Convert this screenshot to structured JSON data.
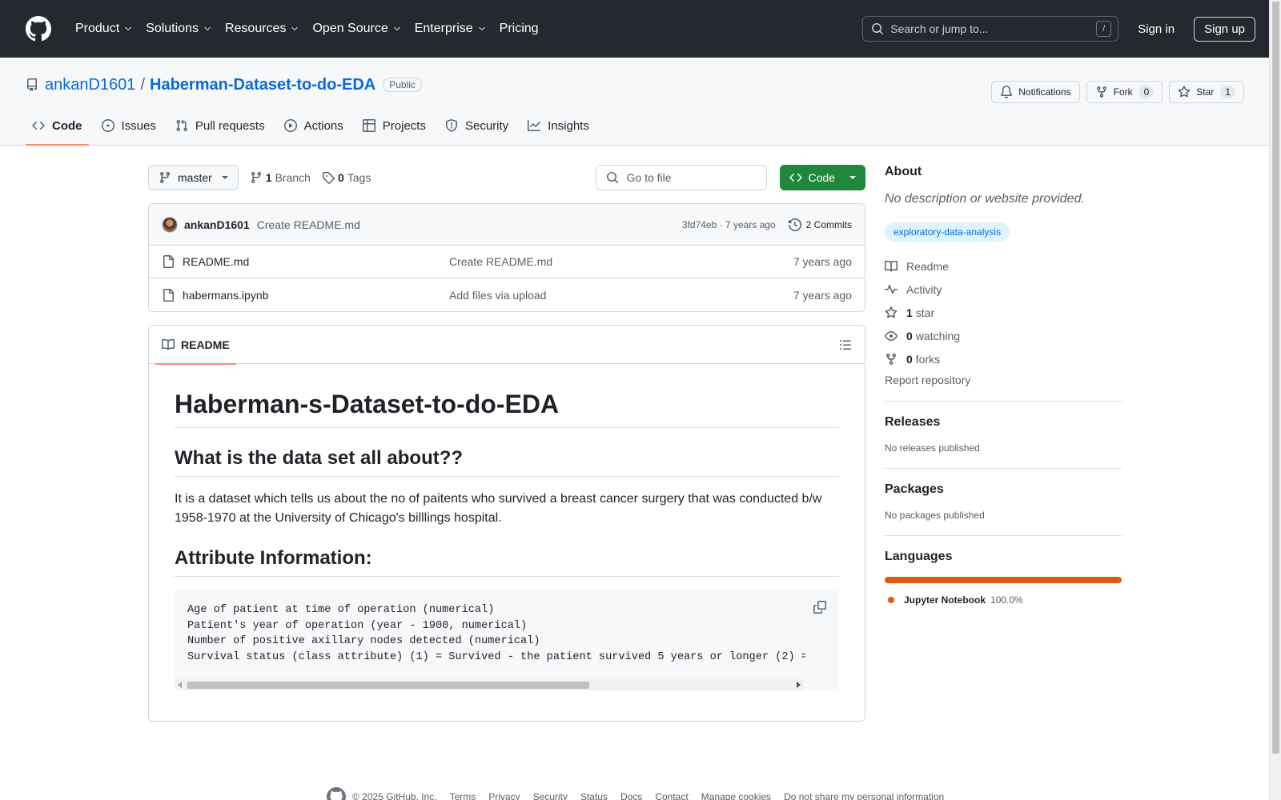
{
  "header": {
    "nav": [
      "Product",
      "Solutions",
      "Resources",
      "Open Source",
      "Enterprise",
      "Pricing"
    ],
    "search_placeholder": "Search or jump to...",
    "search_shortcut": "/",
    "sign_in": "Sign in",
    "sign_up": "Sign up"
  },
  "repo": {
    "owner": "ankanD1601",
    "separator": "/",
    "name": "Haberman-Dataset-to-do-EDA",
    "visibility": "Public",
    "notifications_label": "Notifications",
    "fork_label": "Fork",
    "fork_count": "0",
    "star_label": "Star",
    "star_count": "1"
  },
  "tabs": [
    {
      "label": "Code",
      "icon": "code-icon",
      "active": true
    },
    {
      "label": "Issues",
      "icon": "issue-icon"
    },
    {
      "label": "Pull requests",
      "icon": "pull-request-icon"
    },
    {
      "label": "Actions",
      "icon": "play-icon"
    },
    {
      "label": "Projects",
      "icon": "table-icon"
    },
    {
      "label": "Security",
      "icon": "shield-icon"
    },
    {
      "label": "Insights",
      "icon": "graph-icon"
    }
  ],
  "toolbar": {
    "branch": "master",
    "branch_count": "1",
    "branch_label": "Branch",
    "tag_count": "0",
    "tag_label": "Tags",
    "goto_placeholder": "Go to file",
    "code_label": "Code"
  },
  "commit": {
    "author": "ankanD1601",
    "message": "Create README.md",
    "meta": "3fd74eb · 7 years ago",
    "commits_label": "2 Commits"
  },
  "files": [
    {
      "name": "README.md",
      "message": "Create README.md",
      "date": "7 years ago"
    },
    {
      "name": "habermans.ipynb",
      "message": "Add files via upload",
      "date": "7 years ago"
    }
  ],
  "readme": {
    "tab_label": "README",
    "h1": "Haberman-s-Dataset-to-do-EDA",
    "h2_about": "What is the data set all about??",
    "paragraph": "It is a dataset which tells us about the no of paitents who survived a breast cancer surgery that was conducted b/w 1958-1970 at the University of Chicago's billlings hospital.",
    "h2_attr": "Attribute Information:",
    "code_lines": [
      "Age of patient at time of operation (numerical)",
      "Patient's year of operation (year - 1900, numerical)",
      "Number of positive axillary nodes detected (numerical)",
      "Survival status (class attribute) (1) = Survived - the patient survived 5 years or longer (2) ="
    ]
  },
  "sidebar": {
    "about_title": "About",
    "about_desc": "No description or website provided.",
    "topic": "exploratory-data-analysis",
    "readme_link": "Readme",
    "activity_link": "Activity",
    "stars_count": "1",
    "stars_label": "star",
    "watching_count": "0",
    "watching_label": "watching",
    "forks_count": "0",
    "forks_label": "forks",
    "report": "Report repository",
    "releases_title": "Releases",
    "releases_text": "No releases published",
    "packages_title": "Packages",
    "packages_text": "No packages published",
    "languages_title": "Languages",
    "language_name": "Jupyter Notebook",
    "language_pct": "100.0%",
    "language_color": "#da5b0b"
  },
  "footer": {
    "copyright": "© 2025 GitHub, Inc.",
    "links": [
      "Terms",
      "Privacy",
      "Security",
      "Status",
      "Docs",
      "Contact",
      "Manage cookies",
      "Do not share my personal information"
    ]
  }
}
